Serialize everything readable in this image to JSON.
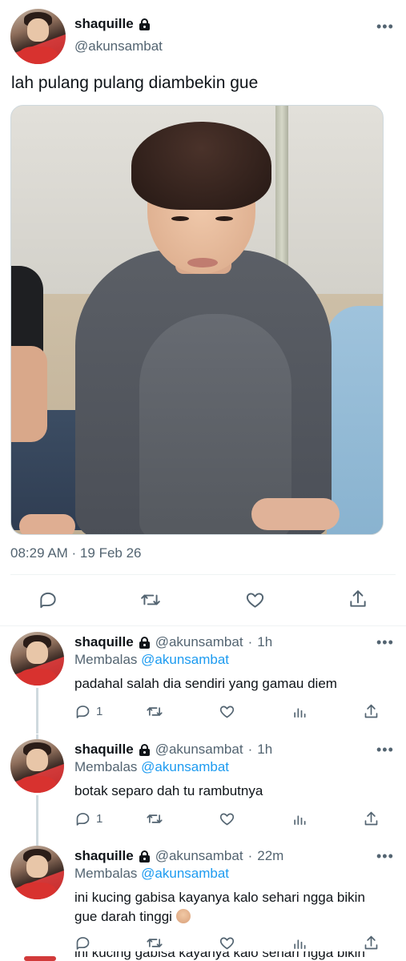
{
  "main_tweet": {
    "display_name": "shaquille",
    "handle": "@akunsambat",
    "text": "lah pulang pulang diambekin gue",
    "timestamp": "08:29 AM · 19 Feb 26",
    "icons": {
      "lock": "lock-icon",
      "more": "more-icon",
      "reply": "reply-icon",
      "retweet": "retweet-icon",
      "like": "heart-icon",
      "share": "share-icon"
    }
  },
  "replies": [
    {
      "display_name": "shaquille",
      "handle": "@akunsambat",
      "time": "1h",
      "replying_label": "Membalas",
      "replying_to": "@akunsambat",
      "text": "padahal salah dia sendiri yang gamau diem",
      "reply_count": "1"
    },
    {
      "display_name": "shaquille",
      "handle": "@akunsambat",
      "time": "1h",
      "replying_label": "Membalas",
      "replying_to": "@akunsambat",
      "text": "botak separo dah tu rambutnya",
      "reply_count": "1"
    },
    {
      "display_name": "shaquille",
      "handle": "@akunsambat",
      "time": "22m",
      "replying_label": "Membalas",
      "replying_to": "@akunsambat",
      "text": "ini kucing gabisa kayanya kalo sehari ngga bikin gue darah tinggi",
      "emoji": "facepalm-emoji",
      "reply_count": ""
    }
  ],
  "cut_off_text": "ini kucing gabisa kayanya kalo sehari ngga bikin",
  "colors": {
    "text_primary": "#0f1419",
    "text_secondary": "#536471",
    "link": "#1d9bf0",
    "divider": "#eff3f4"
  }
}
